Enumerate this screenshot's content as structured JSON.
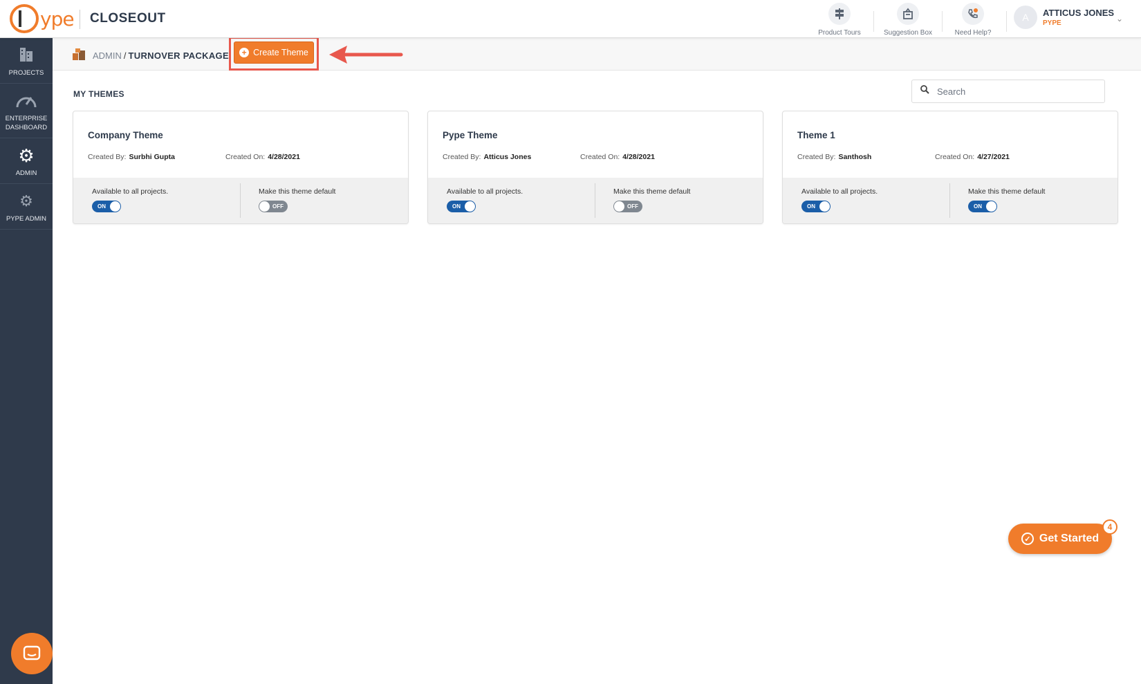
{
  "header": {
    "logo_text": "ype",
    "app_title": "CLOSEOUT",
    "tools": [
      {
        "label": "Product Tours",
        "icon": "signpost-icon"
      },
      {
        "label": "Suggestion Box",
        "icon": "suggestion-box-icon"
      },
      {
        "label": "Need Help?",
        "icon": "phone-help-icon"
      }
    ],
    "user": {
      "initial": "A",
      "name": "ATTICUS JONES",
      "org": "PYPE"
    }
  },
  "sidebar": {
    "items": [
      {
        "label": "PROJECTS",
        "icon": "building-icon"
      },
      {
        "label": "ENTERPRISE DASHBOARD",
        "icon": "speedometer-icon"
      },
      {
        "label": "ADMIN",
        "icon": "gear-icon"
      },
      {
        "label": "PYPE ADMIN",
        "icon": "gears-icon"
      }
    ]
  },
  "breadcrumb": {
    "parent": "ADMIN",
    "separator": "/",
    "current": "TURNOVER PACKAGE"
  },
  "actions": {
    "create_theme": "Create Theme"
  },
  "main": {
    "section_title": "MY THEMES",
    "search": {
      "placeholder": "Search",
      "value": ""
    },
    "labels": {
      "created_by": "Created By:",
      "created_on": "Created On:",
      "available": "Available to all projects.",
      "default": "Make this theme default",
      "on": "ON",
      "off": "OFF"
    },
    "themes": [
      {
        "name": "Company Theme",
        "created_by": "Surbhi Gupta",
        "created_on": "4/28/2021",
        "available": true,
        "is_default": false
      },
      {
        "name": "Pype Theme",
        "created_by": "Atticus Jones",
        "created_on": "4/28/2021",
        "available": true,
        "is_default": false
      },
      {
        "name": "Theme 1",
        "created_by": "Santhosh",
        "created_on": "4/27/2021",
        "available": true,
        "is_default": true
      }
    ]
  },
  "get_started": {
    "label": "Get Started",
    "badge": "4"
  },
  "colors": {
    "accent": "#f07c2b",
    "sidebar": "#2f3a4b",
    "toggle_on": "#1b5ea8",
    "toggle_off": "#7f8790",
    "highlight": "#e8584d"
  }
}
